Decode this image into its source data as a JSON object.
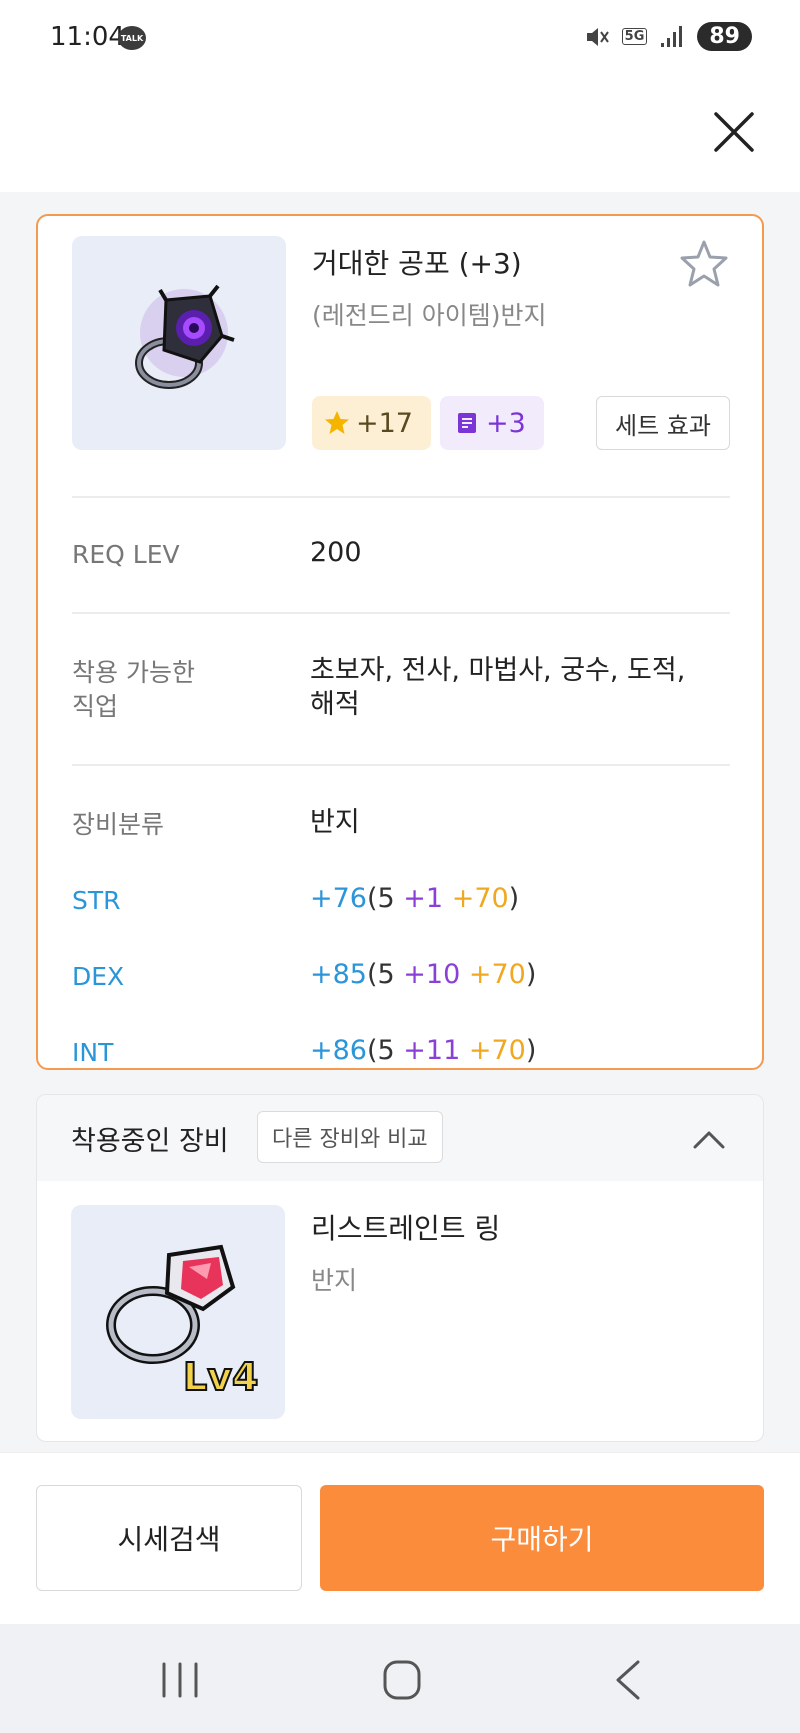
{
  "status_bar": {
    "time": "11:04",
    "talk_label": "TALK",
    "network": "5G",
    "battery": "89"
  },
  "item": {
    "name": "거대한 공포 (+3)",
    "type": "(레전드리 아이템)반지",
    "star_force": "+17",
    "scroll_upgrades": "+3",
    "set_effect_label": "세트 효과",
    "image_icon": "purple-eye-ring-icon"
  },
  "details": {
    "req_level_label": "REQ LEV",
    "req_level_value": "200",
    "jobs_label_line1": "착용 가능한",
    "jobs_label_line2": "직업",
    "jobs_value_line1": "초보자, 전사, 마법사, 궁수, 도적,",
    "jobs_value_line2": "해적",
    "category_label": "장비분류",
    "category_value": "반지"
  },
  "stats": [
    {
      "label": "STR",
      "total": "+76",
      "open": "(",
      "base": "5",
      "scroll": " +1",
      "star": " +70",
      "close": ")"
    },
    {
      "label": "DEX",
      "total": "+85",
      "open": "(",
      "base": "5",
      "scroll": " +10",
      "star": " +70",
      "close": ")"
    },
    {
      "label": "INT",
      "total": "+86",
      "open": "(",
      "base": "5",
      "scroll": " +11",
      "star": " +70",
      "close": ")"
    }
  ],
  "equipped": {
    "title": "착용중인 장비",
    "compare_label": "다른 장비와 비교",
    "name": "리스트레인트 링",
    "type": "반지",
    "level_badge": "Lv4"
  },
  "actions": {
    "price_search": "시세검색",
    "buy": "구매하기"
  },
  "colors": {
    "accent": "#fb8c3c",
    "card_border": "#f39a50",
    "stat_blue": "#2b95d9",
    "scroll_purple": "#8a3fd6",
    "star_gold": "#f0a820"
  }
}
